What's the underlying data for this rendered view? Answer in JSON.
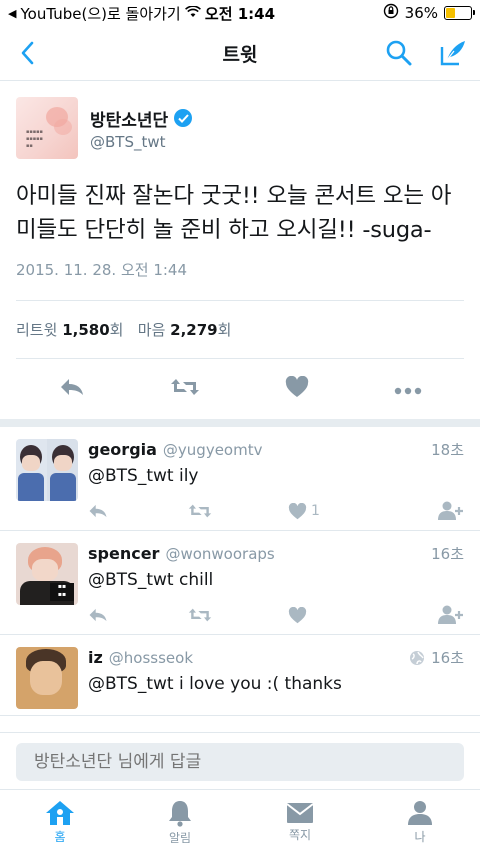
{
  "statusbar": {
    "back_app": "YouTube(으)로 돌아가기",
    "time": "오전 1:44",
    "battery": "36%",
    "battery_level": 0.36
  },
  "navbar": {
    "title": "트윗",
    "back_icon": "chevron-left-icon",
    "search_icon": "search-icon",
    "compose_icon": "compose-quill-icon"
  },
  "tweet": {
    "author_name": "방탄소년단",
    "author_handle": "@BTS_twt",
    "verified": true,
    "text": "아미들 진짜 잘논다 굿굿!! 오늘 콘서트 오는 아미들도 단단히 놀 준비 하고 오시길!! -suga-",
    "timestamp": "2015. 11. 28. 오전 1:44",
    "retweet_label": "리트윗",
    "retweet_count": "1,580",
    "like_label": "마음",
    "like_count": "2,279",
    "count_unit": "회"
  },
  "replies": [
    {
      "name": "georgia",
      "handle": "@yugyeomtv",
      "time": "18초",
      "text": "@BTS_twt ily",
      "like_count": "1",
      "globe": false
    },
    {
      "name": "spencer",
      "handle": "@wonwooraps",
      "time": "16초",
      "text": "@BTS_twt chill",
      "like_count": "",
      "globe": false
    },
    {
      "name": "iz",
      "handle": "@hossseok",
      "time": "16초",
      "text": "@BTS_twt i love you :( thanks",
      "like_count": "",
      "globe": true
    }
  ],
  "composer": {
    "placeholder": "방탄소년단 님에게 답글"
  },
  "tabs": [
    {
      "label": "홈",
      "icon": "home-icon",
      "active": true
    },
    {
      "label": "알림",
      "icon": "bell-icon",
      "active": false
    },
    {
      "label": "쪽지",
      "icon": "envelope-icon",
      "active": false
    },
    {
      "label": "나",
      "icon": "person-icon",
      "active": false
    }
  ],
  "colors": {
    "accent": "#1da1f2",
    "muted": "#8899a6",
    "battery_fill": "#f5c000"
  }
}
